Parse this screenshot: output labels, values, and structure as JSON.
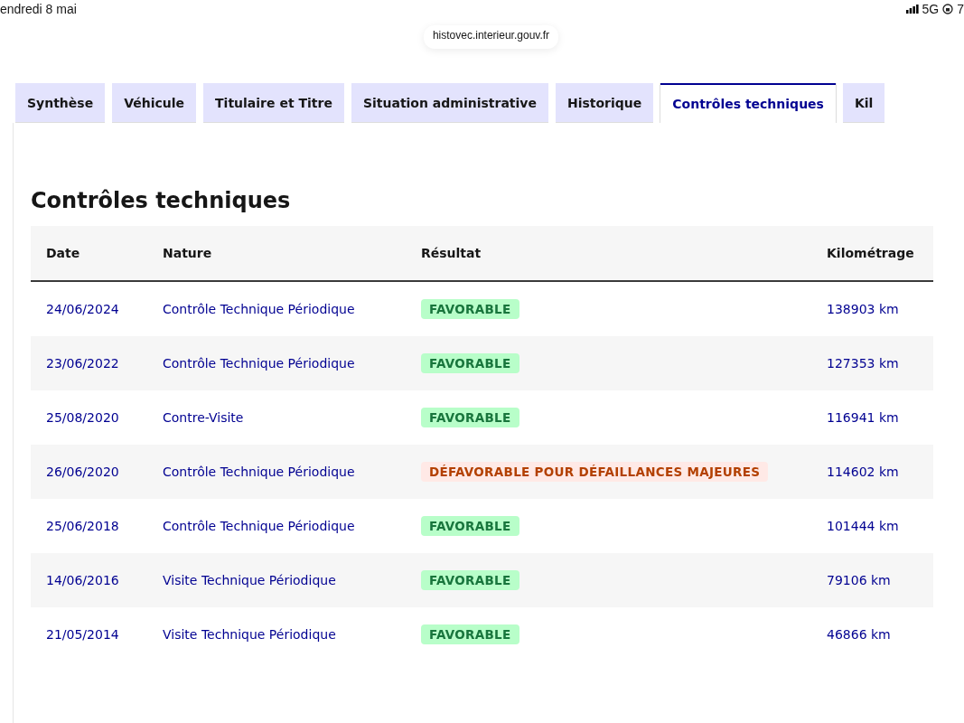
{
  "status_bar": {
    "date": "endredi 8 mai",
    "network": "5G",
    "battery": "7"
  },
  "url_bar": {
    "url": "histovec.interieur.gouv.fr"
  },
  "tabs": [
    {
      "label": "Synthèse",
      "selected": false
    },
    {
      "label": "Véhicule",
      "selected": false
    },
    {
      "label": "Titulaire et Titre",
      "selected": false
    },
    {
      "label": "Situation administrative",
      "selected": false
    },
    {
      "label": "Historique",
      "selected": false
    },
    {
      "label": "Contrôles techniques",
      "selected": true
    },
    {
      "label": "Kil",
      "selected": false
    }
  ],
  "section": {
    "title": "Contrôles techniques",
    "table": {
      "columns": [
        "Date",
        "Nature",
        "Résultat",
        "Kilométrage"
      ],
      "rows": [
        {
          "date": "24/06/2024",
          "nature": "Contrôle Technique Périodique",
          "result": {
            "label": "FAVORABLE",
            "kind": "success"
          },
          "mileage": "138903 km"
        },
        {
          "date": "23/06/2022",
          "nature": "Contrôle Technique Périodique",
          "result": {
            "label": "FAVORABLE",
            "kind": "success"
          },
          "mileage": "127353 km"
        },
        {
          "date": "25/08/2020",
          "nature": "Contre-Visite",
          "result": {
            "label": "FAVORABLE",
            "kind": "success"
          },
          "mileage": "116941 km"
        },
        {
          "date": "26/06/2020",
          "nature": "Contrôle Technique Périodique",
          "result": {
            "label": "DÉFAVORABLE POUR DÉFAILLANCES MAJEURES",
            "kind": "error"
          },
          "mileage": "114602 km"
        },
        {
          "date": "25/06/2018",
          "nature": "Contrôle Technique Périodique",
          "result": {
            "label": "FAVORABLE",
            "kind": "success"
          },
          "mileage": "101444 km"
        },
        {
          "date": "14/06/2016",
          "nature": "Visite Technique Périodique",
          "result": {
            "label": "FAVORABLE",
            "kind": "success"
          },
          "mileage": "79106 km"
        },
        {
          "date": "21/05/2014",
          "nature": "Visite Technique Périodique",
          "result": {
            "label": "FAVORABLE",
            "kind": "success"
          },
          "mileage": "46866 km"
        }
      ]
    }
  }
}
